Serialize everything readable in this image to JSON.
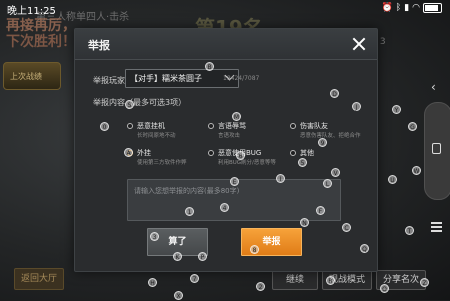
{
  "status_bar": {
    "time": "晚上11:25",
    "icons": [
      "alarm-icon",
      "bluetooth-icon",
      "signal-icon",
      "wifi-icon",
      "battery-icon"
    ],
    "battery_level": 0.85
  },
  "background": {
    "faded_top": "第三人称单四人·击杀",
    "line1": "再接再厉，",
    "line2": "下次胜利！",
    "score": "第19名",
    "sub": "分 3",
    "badge": "上次战绩",
    "bottom_left": "返回大厅",
    "bottom_buttons": [
      "继续",
      "观战模式",
      "分享名次"
    ]
  },
  "dialog": {
    "title": "举报",
    "player_label": "举报玩家:",
    "player_value": "【对手】糯米茶圆子",
    "player_id": "18424/7087",
    "content_label": "举报内容（最多可选3项）",
    "options": [
      {
        "name": "恶意挂机",
        "desc": "长时间原地不动",
        "checked": false
      },
      {
        "name": "言语辱骂",
        "desc": "言语攻击",
        "checked": false
      },
      {
        "name": "伤害队友",
        "desc": "恶意伤害队友、拒绝合作",
        "checked": false
      },
      {
        "name": "外挂",
        "desc": "使用第三方软件作弊",
        "checked": true
      },
      {
        "name": "恶意使用BUG",
        "desc": "利用BUG刷分/恶意等等",
        "checked": false
      },
      {
        "name": "其他",
        "desc": "",
        "checked": false
      }
    ],
    "textarea_placeholder": "请输入您想举报的内容(最多80字)",
    "cancel_label": "算了",
    "report_label": "举报"
  },
  "colors": {
    "accent": "#f09a2a",
    "dialog_bg": "#2a2c2e",
    "header_bg": "#35393c"
  },
  "touch_markers": [
    "0",
    "1",
    "2",
    "3",
    "4",
    "5",
    "6",
    "7",
    "8",
    "9",
    "A",
    "B",
    "C",
    "D",
    "E",
    "F",
    "G",
    "H",
    "I",
    "J",
    "K",
    "L",
    "M",
    "N",
    "O",
    "P",
    "Q",
    "R",
    "S",
    "T",
    "U",
    "V",
    "W",
    "X",
    "Y",
    "Z"
  ]
}
